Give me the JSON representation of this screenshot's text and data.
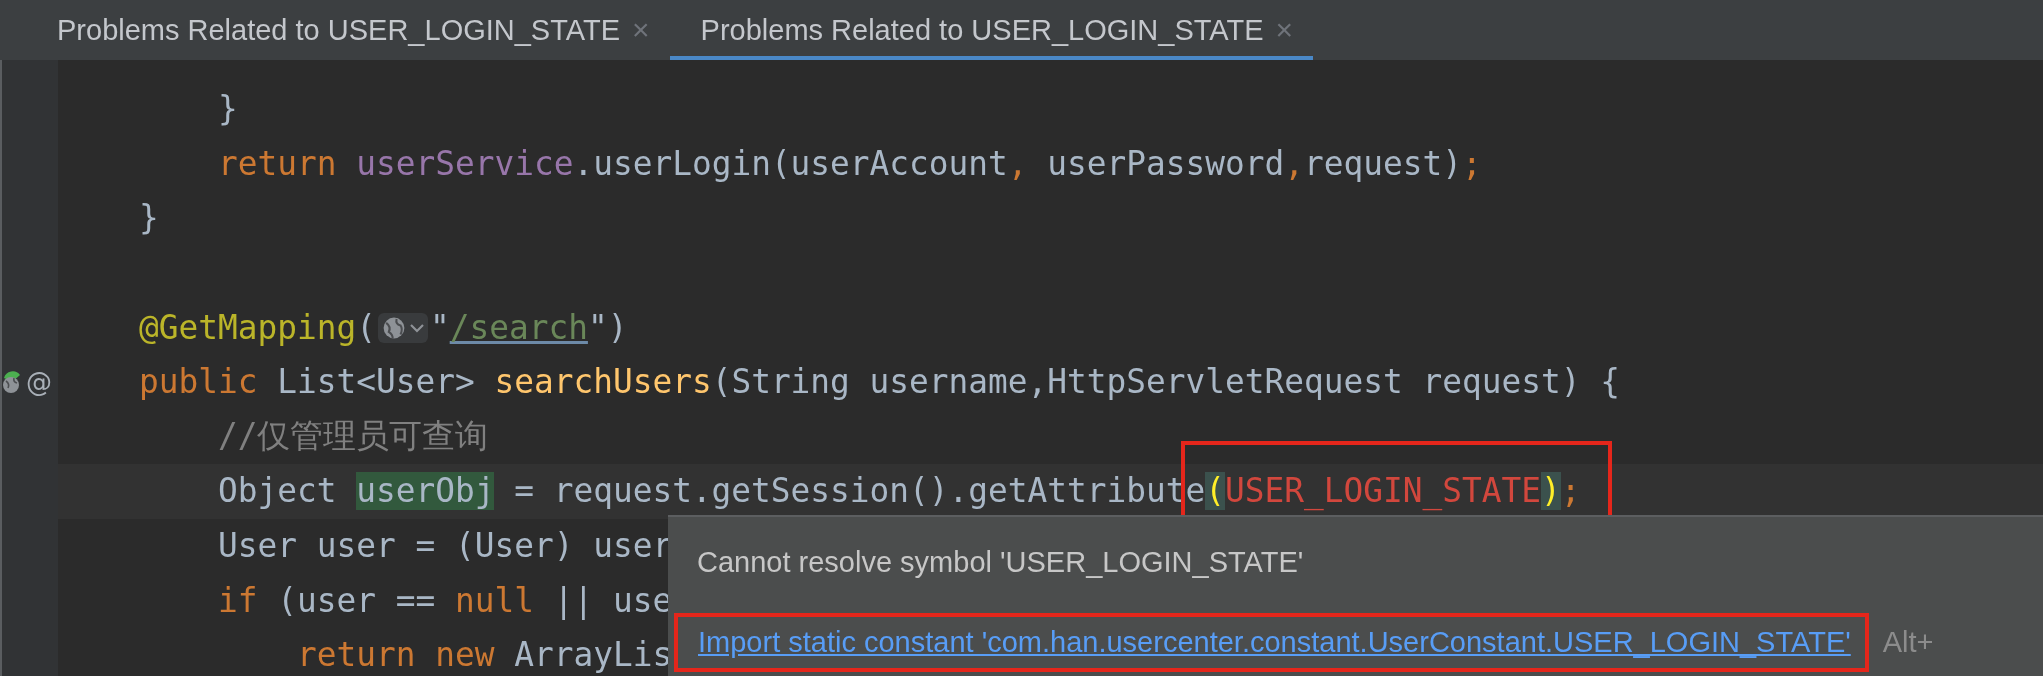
{
  "tabs": [
    {
      "label": "Problems Related to USER_LOGIN_STATE",
      "close": "×",
      "selected": false
    },
    {
      "label": "Problems Related to USER_LOGIN_STATE",
      "close": "×",
      "selected": true
    }
  ],
  "editor": {
    "lines": [
      {
        "kind": "code",
        "tokens": [
          {
            "text": "    }",
            "kind": "plain"
          }
        ]
      },
      {
        "kind": "code",
        "tokens": [
          {
            "text": "    return",
            "kind": "keyword"
          },
          {
            "text": " userService",
            "kind": "field"
          },
          {
            "text": ".userLogin(userAccount",
            "kind": "plain"
          },
          {
            "text": ",",
            "kind": "keyword"
          },
          {
            "text": " userPassword",
            "kind": "plain"
          },
          {
            "text": ",",
            "kind": "keyword"
          },
          {
            "text": "request)",
            "kind": "plain"
          },
          {
            "text": ";",
            "kind": "keyword"
          }
        ]
      },
      {
        "kind": "code",
        "tokens": [
          {
            "text": "}",
            "kind": "plain"
          }
        ]
      },
      {
        "kind": "blank"
      },
      {
        "kind": "code",
        "tokens": [
          {
            "text": "@GetMapping",
            "kind": "annotation"
          },
          {
            "text": "(",
            "kind": "plain"
          },
          {
            "kind": "inlay"
          },
          {
            "text": "\"",
            "kind": "plain"
          },
          {
            "text": "/search",
            "kind": "link"
          },
          {
            "text": "\")",
            "kind": "plain"
          }
        ]
      },
      {
        "kind": "code",
        "gutter": [
          {
            "kind": "globe"
          },
          {
            "kind": "text",
            "text": "@"
          }
        ],
        "tokens": [
          {
            "text": "public",
            "kind": "keyword"
          },
          {
            "text": " List<User> ",
            "kind": "plain"
          },
          {
            "text": "searchUsers",
            "kind": "method"
          },
          {
            "text": "(String username,HttpServletRequest request) {",
            "kind": "plain"
          }
        ]
      },
      {
        "kind": "code",
        "tokens": [
          {
            "text": "    //仅管理员可查询",
            "kind": "comment"
          }
        ]
      },
      {
        "kind": "code",
        "current": true,
        "tokens": [
          {
            "text": "    Object ",
            "kind": "plain"
          },
          {
            "text": "userObj",
            "kind": "usage"
          },
          {
            "text": " = request.getSession().getAttribute",
            "kind": "plain"
          },
          {
            "text": "(",
            "kind": "brace",
            "annotated": true
          },
          {
            "text": "USER_LOGIN_STATE",
            "kind": "error",
            "annotated": true
          },
          {
            "text": ")",
            "kind": "brace",
            "annotated": true
          },
          {
            "text": ";",
            "kind": "keyword",
            "annotated": true
          }
        ]
      },
      {
        "kind": "code",
        "tokens": [
          {
            "text": "    User user = (User) user",
            "kind": "plain"
          }
        ]
      },
      {
        "kind": "code",
        "tokens": [
          {
            "text": "    if",
            "kind": "keyword"
          },
          {
            "text": " (user == ",
            "kind": "plain"
          },
          {
            "text": "null",
            "kind": "keyword"
          },
          {
            "text": " || use",
            "kind": "plain"
          }
        ]
      },
      {
        "kind": "code",
        "tokens": [
          {
            "text": "        return new",
            "kind": "keyword"
          },
          {
            "text": " ArrayLis",
            "kind": "plain"
          }
        ]
      }
    ]
  },
  "popup": {
    "message": "Cannot resolve symbol 'USER_LOGIN_STATE'",
    "action": {
      "label": "Import static constant 'com.han.usercenter.constant.UserConstant.USER_LOGIN_STATE'",
      "annotated": true
    },
    "shortcut": "Alt+"
  }
}
